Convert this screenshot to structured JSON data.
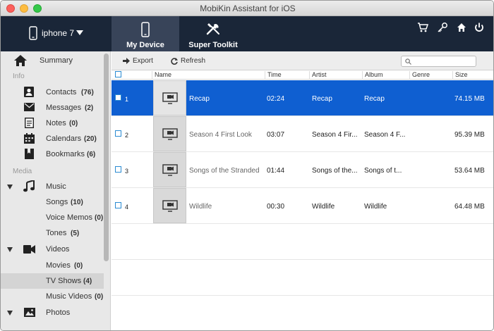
{
  "window": {
    "title": "MobiKin Assistant for iOS"
  },
  "header": {
    "device_name": "iphone 7",
    "tabs": [
      {
        "label": "My Device"
      },
      {
        "label": "Super Toolkit"
      }
    ]
  },
  "sidebar": {
    "summary": "Summary",
    "info_section": "Info",
    "info_items": [
      {
        "label": "Contacts",
        "count": "(76)"
      },
      {
        "label": "Messages",
        "count": "(2)"
      },
      {
        "label": "Notes",
        "count": "(0)"
      },
      {
        "label": "Calendars",
        "count": "(20)"
      },
      {
        "label": "Bookmarks",
        "count": "(6)"
      }
    ],
    "media_section": "Media",
    "music": {
      "label": "Music"
    },
    "music_items": [
      {
        "label": "Songs",
        "count": "(10)"
      },
      {
        "label": "Voice Memos",
        "count": "(0)"
      },
      {
        "label": "Tones",
        "count": "(5)"
      }
    ],
    "videos": {
      "label": "Videos"
    },
    "video_items": [
      {
        "label": "Movies",
        "count": "(0)"
      },
      {
        "label": "TV Shows",
        "count": "(4)"
      },
      {
        "label": "Music Videos",
        "count": "(0)"
      }
    ],
    "photos": {
      "label": "Photos"
    }
  },
  "toolbar": {
    "export_label": "Export",
    "refresh_label": "Refresh",
    "search_placeholder": ""
  },
  "table": {
    "columns": [
      "Name",
      "Time",
      "Artist",
      "Album",
      "Genre",
      "Size"
    ],
    "rows": [
      {
        "num": "1",
        "name": "Recap",
        "time": "02:24",
        "artist": "Recap",
        "album": "Recap",
        "genre": "",
        "size": "74.15 MB",
        "selected": true
      },
      {
        "num": "2",
        "name": "Season 4 First Look",
        "time": "03:07",
        "artist": "Season 4 Fir...",
        "album": "Season 4 F...",
        "genre": "",
        "size": "95.39 MB",
        "selected": false
      },
      {
        "num": "3",
        "name": "Songs of the Stranded",
        "time": "01:44",
        "artist": "Songs of the...",
        "album": "Songs of t...",
        "genre": "",
        "size": "53.64 MB",
        "selected": false
      },
      {
        "num": "4",
        "name": "Wildlife",
        "time": "00:30",
        "artist": "Wildlife",
        "album": "Wildlife",
        "genre": "",
        "size": "64.48 MB",
        "selected": false
      }
    ]
  },
  "colors": {
    "header_bg": "#1a2638",
    "active_tab": "#384459",
    "selection": "#0f5fd1"
  }
}
